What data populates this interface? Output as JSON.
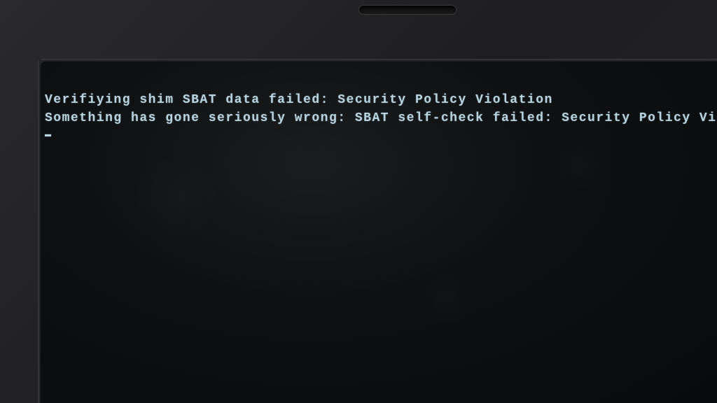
{
  "boot_messages": {
    "line1": "Verifiying shim SBAT data failed: Security Policy Violation",
    "line2": "Something has gone seriously wrong: SBAT self-check failed: Security Policy Violation"
  },
  "colors": {
    "text": "#b8d4e0",
    "screen_bg": "#0e1012",
    "bezel": "#2a2a2c"
  }
}
